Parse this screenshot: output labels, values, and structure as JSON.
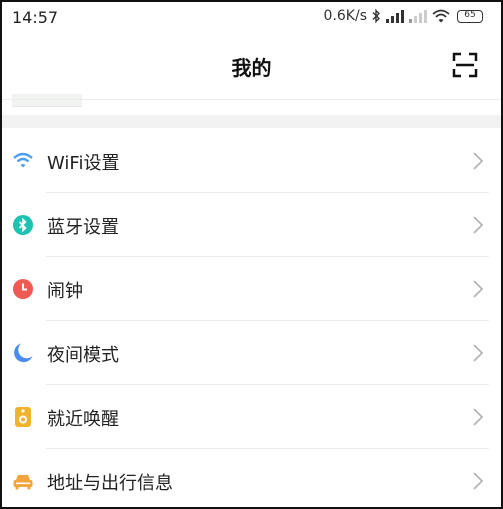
{
  "status_bar": {
    "time": "14:57",
    "network_speed": "0.6K/s",
    "icons": [
      "bluetooth-icon",
      "signal-icon",
      "signal-weak-icon",
      "wifi-icon"
    ],
    "battery": "65"
  },
  "header": {
    "title": "我的",
    "scan_icon": "scan-icon"
  },
  "menu": {
    "items": [
      {
        "label": "WiFi设置",
        "icon": "wifi-icon",
        "color": "#4a9ff5"
      },
      {
        "label": "蓝牙设置",
        "icon": "bluetooth-icon",
        "color": "#1fc1b0"
      },
      {
        "label": "闹钟",
        "icon": "alarm-clock-icon",
        "color": "#f05a55"
      },
      {
        "label": "夜间模式",
        "icon": "moon-icon",
        "color": "#4b8cf0"
      },
      {
        "label": "就近唤醒",
        "icon": "speaker-icon",
        "color": "#f1b32c"
      },
      {
        "label": "地址与出行信息",
        "icon": "car-icon",
        "color": "#f3a53b"
      }
    ]
  }
}
